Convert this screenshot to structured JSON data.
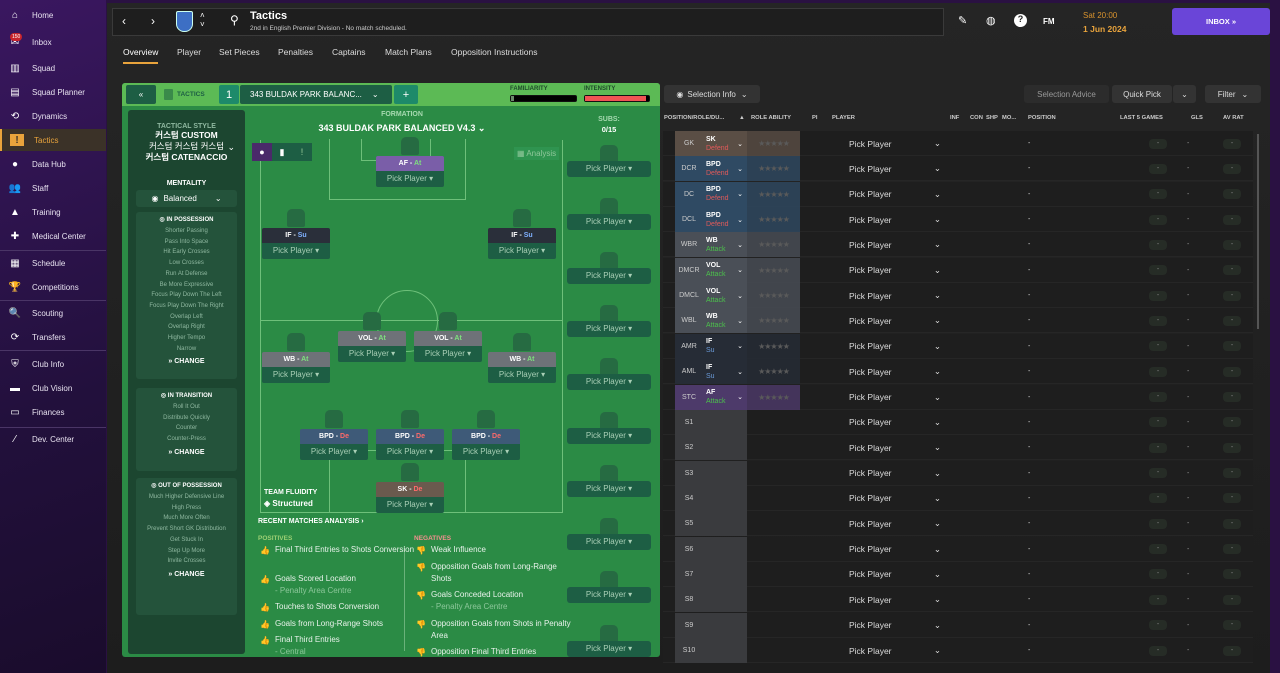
{
  "sidebar": {
    "items": [
      {
        "label": "Home",
        "icon": "home-icon",
        "glyph": "⌂"
      },
      {
        "label": "Inbox",
        "icon": "inbox-icon",
        "glyph": "✉",
        "badge": "150"
      },
      {
        "label": "Squad",
        "icon": "shirt-icon",
        "glyph": "▥"
      },
      {
        "label": "Squad Planner",
        "icon": "clipboard-icon",
        "glyph": "▤"
      },
      {
        "label": "Dynamics",
        "icon": "dynamics-icon",
        "glyph": "⟲"
      },
      {
        "label": "Tactics",
        "icon": "tactics-icon",
        "glyph": "!",
        "active": true
      },
      {
        "label": "Data Hub",
        "icon": "data-hub-icon",
        "glyph": "●"
      },
      {
        "label": "Staff",
        "icon": "staff-icon",
        "glyph": "👥"
      },
      {
        "label": "Training",
        "icon": "training-icon",
        "glyph": "▲"
      },
      {
        "label": "Medical Center",
        "icon": "medical-icon",
        "glyph": "✚"
      },
      {
        "label": "Schedule",
        "icon": "calendar-icon",
        "glyph": "▦"
      },
      {
        "label": "Competitions",
        "icon": "trophy-icon",
        "glyph": "🏆"
      },
      {
        "label": "Scouting",
        "icon": "search-icon",
        "glyph": "🔍"
      },
      {
        "label": "Transfers",
        "icon": "transfers-icon",
        "glyph": "⟳"
      },
      {
        "label": "Club Info",
        "icon": "shield-icon",
        "glyph": "⛨"
      },
      {
        "label": "Club Vision",
        "icon": "briefcase-icon",
        "glyph": "▬"
      },
      {
        "label": "Finances",
        "icon": "money-icon",
        "glyph": "▭"
      },
      {
        "label": "Dev. Center",
        "icon": "dev-center-icon",
        "glyph": "⁄"
      }
    ]
  },
  "header": {
    "title": "Tactics",
    "subtitle": "2nd in English Premier Division - No match scheduled.",
    "fm": "FM",
    "date_time": "Sat 20:00",
    "date": "1 Jun 2024",
    "inbox": "INBOX »"
  },
  "tabs": [
    "Overview",
    "Player",
    "Set Pieces",
    "Penalties",
    "Captains",
    "Match Plans",
    "Opposition Instructions"
  ],
  "tactics": {
    "label": "TACTICS",
    "slot": "1",
    "name": "343 BULDAK PARK BALANC...",
    "familiarity_label": "FAMILIARITY",
    "familiarity": 0.05,
    "intensity_label": "INTENSITY",
    "intensity": 0.95,
    "style_label": "TACTICAL STYLE",
    "style_line1": "커스텀 CUSTOM",
    "style_line2": "커스텀 커스텀 커스텀",
    "style_line3": "커스텀 CATENACCIO",
    "mentality_label": "MENTALITY",
    "mentality": "Balanced",
    "in_possession": {
      "title": "IN POSSESSION",
      "items": [
        "Shorter Passing",
        "Pass Into Space",
        "Hit Early Crosses",
        "Low Crosses",
        "Run At Defense",
        "Be More Expressive",
        "Focus Play Down The Left",
        "Focus Play Down The Right",
        "Overlap Left",
        "Overlap Right",
        "Higher Tempo",
        "Narrow"
      ]
    },
    "in_transition": {
      "title": "IN TRANSITION",
      "items": [
        "Roll It Out",
        "Distribute Quickly",
        "Counter",
        "Counter-Press"
      ]
    },
    "out_of_possession": {
      "title": "OUT OF POSSESSION",
      "items": [
        "Much Higher Defensive Line",
        "High Press",
        "Much More Often",
        "Prevent Short GK Distribution",
        "Get Stuck In",
        "Step Up More",
        "Invite Crosses"
      ]
    },
    "change": "» CHANGE",
    "formation_label": "FORMATION",
    "formation": "343 BULDAK PARK BALANCED V4.3",
    "subs_label": "SUBS:",
    "subs": "0/15",
    "analysis": "Analysis",
    "fluidity_label": "TEAM FLUIDITY",
    "fluidity": "Structured",
    "pick": "Pick Player",
    "pitch": [
      {
        "role": "AF",
        "duty": "At",
        "color": "#7a5ea8",
        "dutycolor": "#7ee07e"
      },
      {
        "role": "IF",
        "duty": "Su",
        "color": "#2a2f3a",
        "dutycolor": "#7fb0ff"
      },
      {
        "role": "IF",
        "duty": "Su",
        "color": "#2a2f3a",
        "dutycolor": "#7fb0ff"
      },
      {
        "role": "VOL",
        "duty": "At",
        "color": "#6e7278",
        "dutycolor": "#7ee07e"
      },
      {
        "role": "VOL",
        "duty": "At",
        "color": "#6e7278",
        "dutycolor": "#7ee07e"
      },
      {
        "role": "WB",
        "duty": "At",
        "color": "#6e7278",
        "dutycolor": "#7ee07e"
      },
      {
        "role": "WB",
        "duty": "At",
        "color": "#6e7278",
        "dutycolor": "#7ee07e"
      },
      {
        "role": "BPD",
        "duty": "De",
        "color": "#3e5a78",
        "dutycolor": "#ff6a6a"
      },
      {
        "role": "BPD",
        "duty": "De",
        "color": "#3e5a78",
        "dutycolor": "#ff6a6a"
      },
      {
        "role": "BPD",
        "duty": "De",
        "color": "#3e5a78",
        "dutycolor": "#ff6a6a"
      },
      {
        "role": "SK",
        "duty": "De",
        "color": "#6a5a4e",
        "dutycolor": "#ff6a6a"
      }
    ]
  },
  "analysis": {
    "title": "RECENT MATCHES ANALYSIS ›",
    "positives_label": "POSITIVES",
    "negatives_label": "NEGATIVES",
    "positives": [
      {
        "text": "Final Third Entries to Shots Conversion"
      },
      {
        "text": "Goals Scored Location",
        "sub": "- Penalty Area Centre"
      },
      {
        "text": "Touches to Shots Conversion"
      },
      {
        "text": "Goals from Long-Range Shots"
      },
      {
        "text": "Final Third Entries",
        "sub": "- Central"
      }
    ],
    "negatives": [
      {
        "text": "Weak Influence"
      },
      {
        "text": "Opposition Goals from Long-Range Shots"
      },
      {
        "text": "Goals Conceded Location",
        "sub": "- Penalty Area Centre"
      },
      {
        "text": "Opposition Goals from Shots in Penalty Area"
      },
      {
        "text": "Opposition Final Third Entries"
      }
    ]
  },
  "selection": {
    "selection_info": "Selection Info",
    "selection_advice": "Selection Advice",
    "quick_pick": "Quick Pick",
    "filter": "Filter",
    "columns": [
      "POSITION/ROLE/DU...",
      "ROLE ABILITY",
      "PI",
      "PLAYER",
      "INF",
      "CON",
      "SHP",
      "MO...",
      "POSITION",
      "LAST 5 GAMES",
      "GLS",
      "AV RAT"
    ],
    "rows": [
      {
        "pos": "GK",
        "role": "SK",
        "duty": "Defend",
        "bg": "#5a4e45",
        "dc": "#e05a5a"
      },
      {
        "pos": "DCR",
        "role": "BPD",
        "duty": "Defend",
        "bg": "#2f4a63",
        "dc": "#e05a5a"
      },
      {
        "pos": "DC",
        "role": "BPD",
        "duty": "Defend",
        "bg": "#2f4a63",
        "dc": "#e05a5a"
      },
      {
        "pos": "DCL",
        "role": "BPD",
        "duty": "Defend",
        "bg": "#2f4a63",
        "dc": "#e05a5a"
      },
      {
        "pos": "WBR",
        "role": "WB",
        "duty": "Attack",
        "bg": "#4a4f57",
        "dc": "#4cc04c"
      },
      {
        "pos": "DMCR",
        "role": "VOL",
        "duty": "Attack",
        "bg": "#4a4f57",
        "dc": "#4cc04c"
      },
      {
        "pos": "DMCL",
        "role": "VOL",
        "duty": "Attack",
        "bg": "#4a4f57",
        "dc": "#4cc04c"
      },
      {
        "pos": "WBL",
        "role": "WB",
        "duty": "Attack",
        "bg": "#4a4f57",
        "dc": "#4cc04c"
      },
      {
        "pos": "AMR",
        "role": "IF",
        "duty": "Su",
        "bg": "#262c36",
        "dc": "#6a9ad8"
      },
      {
        "pos": "AML",
        "role": "IF",
        "duty": "Su",
        "bg": "#262c36",
        "dc": "#6a9ad8"
      },
      {
        "pos": "STC",
        "role": "AF",
        "duty": "Attack",
        "bg": "#4d3a6a",
        "dc": "#4cc04c"
      },
      {
        "pos": "S1"
      },
      {
        "pos": "S2"
      },
      {
        "pos": "S3"
      },
      {
        "pos": "S4"
      },
      {
        "pos": "S5"
      },
      {
        "pos": "S6"
      },
      {
        "pos": "S7"
      },
      {
        "pos": "S8"
      },
      {
        "pos": "S9"
      },
      {
        "pos": "S10"
      }
    ],
    "player": "Pick Player",
    "dash": "-"
  }
}
